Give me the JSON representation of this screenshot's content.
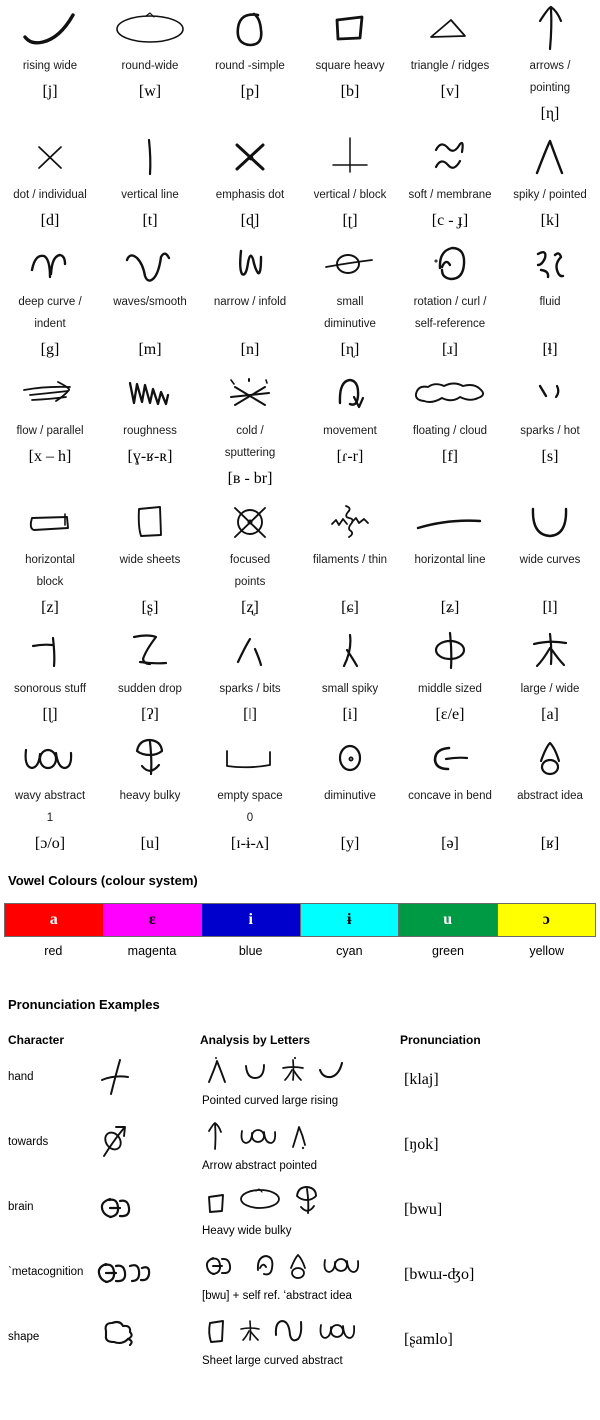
{
  "glyph_chart": {
    "rows": [
      {
        "cells": [
          {
            "icon": "rising-wide-stroke",
            "label": "rising wide",
            "ipa": "[j]"
          },
          {
            "icon": "round-wide-oval",
            "label": "round-wide",
            "ipa": "[w]"
          },
          {
            "icon": "round-simple-circle",
            "label": "round -simple",
            "ipa": "[p]"
          },
          {
            "icon": "square-heavy",
            "label": "square heavy",
            "ipa": "[b]"
          },
          {
            "icon": "triangle-ridges",
            "label": "triangle / ridges",
            "ipa": "[v]"
          },
          {
            "icon": "arrow-pointing",
            "label": "arrows /\npointing",
            "ipa": "[ɳ]"
          }
        ]
      },
      {
        "cells": [
          {
            "icon": "dot-individual-cross",
            "label": "dot / individual",
            "ipa": "[d]"
          },
          {
            "icon": "vertical-line",
            "label": "vertical line",
            "ipa": "[t]"
          },
          {
            "icon": "emphasis-dot-cross",
            "label": "emphasis dot",
            "ipa": "[ɖ]"
          },
          {
            "icon": "vertical-block-tee",
            "label": "vertical / block",
            "ipa": "[ʈ]"
          },
          {
            "icon": "soft-membrane-waves",
            "label": "soft / membrane",
            "ipa": "[c - ɟ]"
          },
          {
            "icon": "spiky-pointed-caret",
            "label": "spiky / pointed",
            "ipa": "[k]"
          }
        ]
      },
      {
        "cells": [
          {
            "icon": "deep-curve-indent",
            "label": "deep curve /\nindent",
            "ipa": "[g]"
          },
          {
            "icon": "waves-smooth",
            "label": "waves/smooth",
            "ipa": "[m]"
          },
          {
            "icon": "narrow-infold",
            "label": "narrow / infold",
            "ipa": "[n]"
          },
          {
            "icon": "small-diminutive-barred-circle",
            "label": "small\ndiminutive",
            "ipa": "[ɳ]"
          },
          {
            "icon": "rotation-curl-self-reference",
            "label": "rotation / curl /\nself-reference",
            "ipa": "[ɹ]"
          },
          {
            "icon": "fluid-squiggle",
            "label": "fluid",
            "ipa": "[ɬ]"
          }
        ]
      },
      {
        "cells": [
          {
            "icon": "flow-parallel-arrow",
            "label": "flow / parallel",
            "ipa": "[x – h]"
          },
          {
            "icon": "roughness-zigzag",
            "label": "roughness",
            "ipa": "[ɣ-ʁ-ʀ]"
          },
          {
            "icon": "cold-sputtering-star",
            "label": "cold /\nsputtering",
            "ipa": "[ʙ - br]"
          },
          {
            "icon": "movement-hook",
            "label": "movement",
            "ipa": "[ɾ-r]"
          },
          {
            "icon": "floating-cloud",
            "label": "floating / cloud",
            "ipa": "[f]"
          },
          {
            "icon": "sparks-hot-ticks",
            "label": "sparks / hot",
            "ipa": "[s]"
          }
        ]
      },
      {
        "cells": [
          {
            "icon": "horizontal-block-rect",
            "label": "horizontal\nblock",
            "ipa": "[z]"
          },
          {
            "icon": "wide-sheets-rect",
            "label": "wide sheets",
            "ipa": "[ʂ]"
          },
          {
            "icon": "focused-points-crossed-circle",
            "label": "focused\npoints",
            "ipa": "[ʐ]"
          },
          {
            "icon": "filaments-thin-squiggle",
            "label": "filaments / thin",
            "ipa": "[ɕ]"
          },
          {
            "icon": "horizontal-line-stroke",
            "label": "horizontal line",
            "ipa": "[ʑ]"
          },
          {
            "icon": "wide-curves-u",
            "label": "wide curves",
            "ipa": "[l]"
          }
        ]
      },
      {
        "cells": [
          {
            "icon": "sonorous-stuff-dash-bar",
            "label": "sonorous stuff",
            "ipa": "[ɭ]"
          },
          {
            "icon": "sudden-drop-zigzag",
            "label": "sudden drop",
            "ipa": "[ʔ]"
          },
          {
            "icon": "sparks-bits-slash",
            "label": "sparks / bits",
            "ipa": "[ǀ]"
          },
          {
            "icon": "small-spiky-lambda",
            "label": "small spiky",
            "ipa": "[i]"
          },
          {
            "icon": "middle-sized-phi",
            "label": "middle sized",
            "ipa": "[ɛ/e]"
          },
          {
            "icon": "large-wide-dai",
            "label": "large / wide",
            "ipa": "[a]"
          }
        ]
      },
      {
        "cells": [
          {
            "icon": "wavy-abstract-1",
            "label": "wavy abstract\n1",
            "ipa": "[ɔ/o]"
          },
          {
            "icon": "heavy-bulky-mushroom",
            "label": "heavy bulky",
            "ipa": "[u]"
          },
          {
            "icon": "empty-space-0",
            "label": "empty space\n0",
            "ipa": "[ɪ-ɨ-ʌ]"
          },
          {
            "icon": "diminutive-dotted-circle",
            "label": "diminutive",
            "ipa": "[y]"
          },
          {
            "icon": "concave-in-bend",
            "label": "concave in bend",
            "ipa": "[ə]"
          },
          {
            "icon": "abstract-idea-drop",
            "label": "abstract idea",
            "ipa": "[ʁ]"
          }
        ]
      }
    ]
  },
  "vowel_colours": {
    "title": "Vowel Colours (colour system)",
    "swatches": [
      {
        "symbol": "a",
        "name": "red",
        "hex": "#FF0000",
        "text_hex": "#FFFFFF"
      },
      {
        "symbol": "ɛ",
        "name": "magenta",
        "hex": "#FF00FF",
        "text_hex": "#000000"
      },
      {
        "symbol": "i",
        "name": "blue",
        "hex": "#0000CC",
        "text_hex": "#FFFFFF"
      },
      {
        "symbol": "ɨ",
        "name": "cyan",
        "hex": "#00FFFF",
        "text_hex": "#000000"
      },
      {
        "symbol": "u",
        "name": "green",
        "hex": "#009944",
        "text_hex": "#FFFFFF"
      },
      {
        "symbol": "ɔ",
        "name": "yellow",
        "hex": "#FFFF00",
        "text_hex": "#000000"
      }
    ]
  },
  "pronunciation": {
    "title": "Pronunciation Examples",
    "columns": {
      "character": "Character",
      "analysis": "Analysis by Letters",
      "pronunciation": "Pronunciation"
    },
    "rows": [
      {
        "word": "hand",
        "char_icon": "hand-glyph",
        "analysis_icons": [
          "caret-pointed",
          "u-curve",
          "star-large",
          "rising-curve"
        ],
        "analysis_text": "Pointed curved large rising",
        "ipa": "[klaj]"
      },
      {
        "word": "towards",
        "char_icon": "towards-glyph",
        "analysis_icons": [
          "up-arrow",
          "wavy-abstract",
          "caret-pointed-small"
        ],
        "analysis_text": "Arrow abstract pointed",
        "ipa": "[ŋok]"
      },
      {
        "word": "brain",
        "char_icon": "brain-glyph",
        "analysis_icons": [
          "square-heavy-small",
          "oval-wide",
          "mushroom-bulky"
        ],
        "analysis_text": "Heavy wide bulky",
        "ipa": "[bwu]"
      },
      {
        "word": "ˋmetacognition",
        "char_icon": "metacognition-glyph",
        "analysis_icons": [
          "brain-small",
          "rotation-curl-small",
          "abstract-drop",
          "wavy-abstract"
        ],
        "analysis_text": "[bwu] + self ref. ʻabstract idea",
        "ipa": "[bwuɹ-ʤo]"
      },
      {
        "word": "shape",
        "char_icon": "shape-glyph",
        "analysis_icons": [
          "sheet-square",
          "star-large-small",
          "wave-curve",
          "wavy-abstract"
        ],
        "analysis_text": "Sheet large curved abstract",
        "ipa": "[ʂamlo]"
      }
    ]
  }
}
